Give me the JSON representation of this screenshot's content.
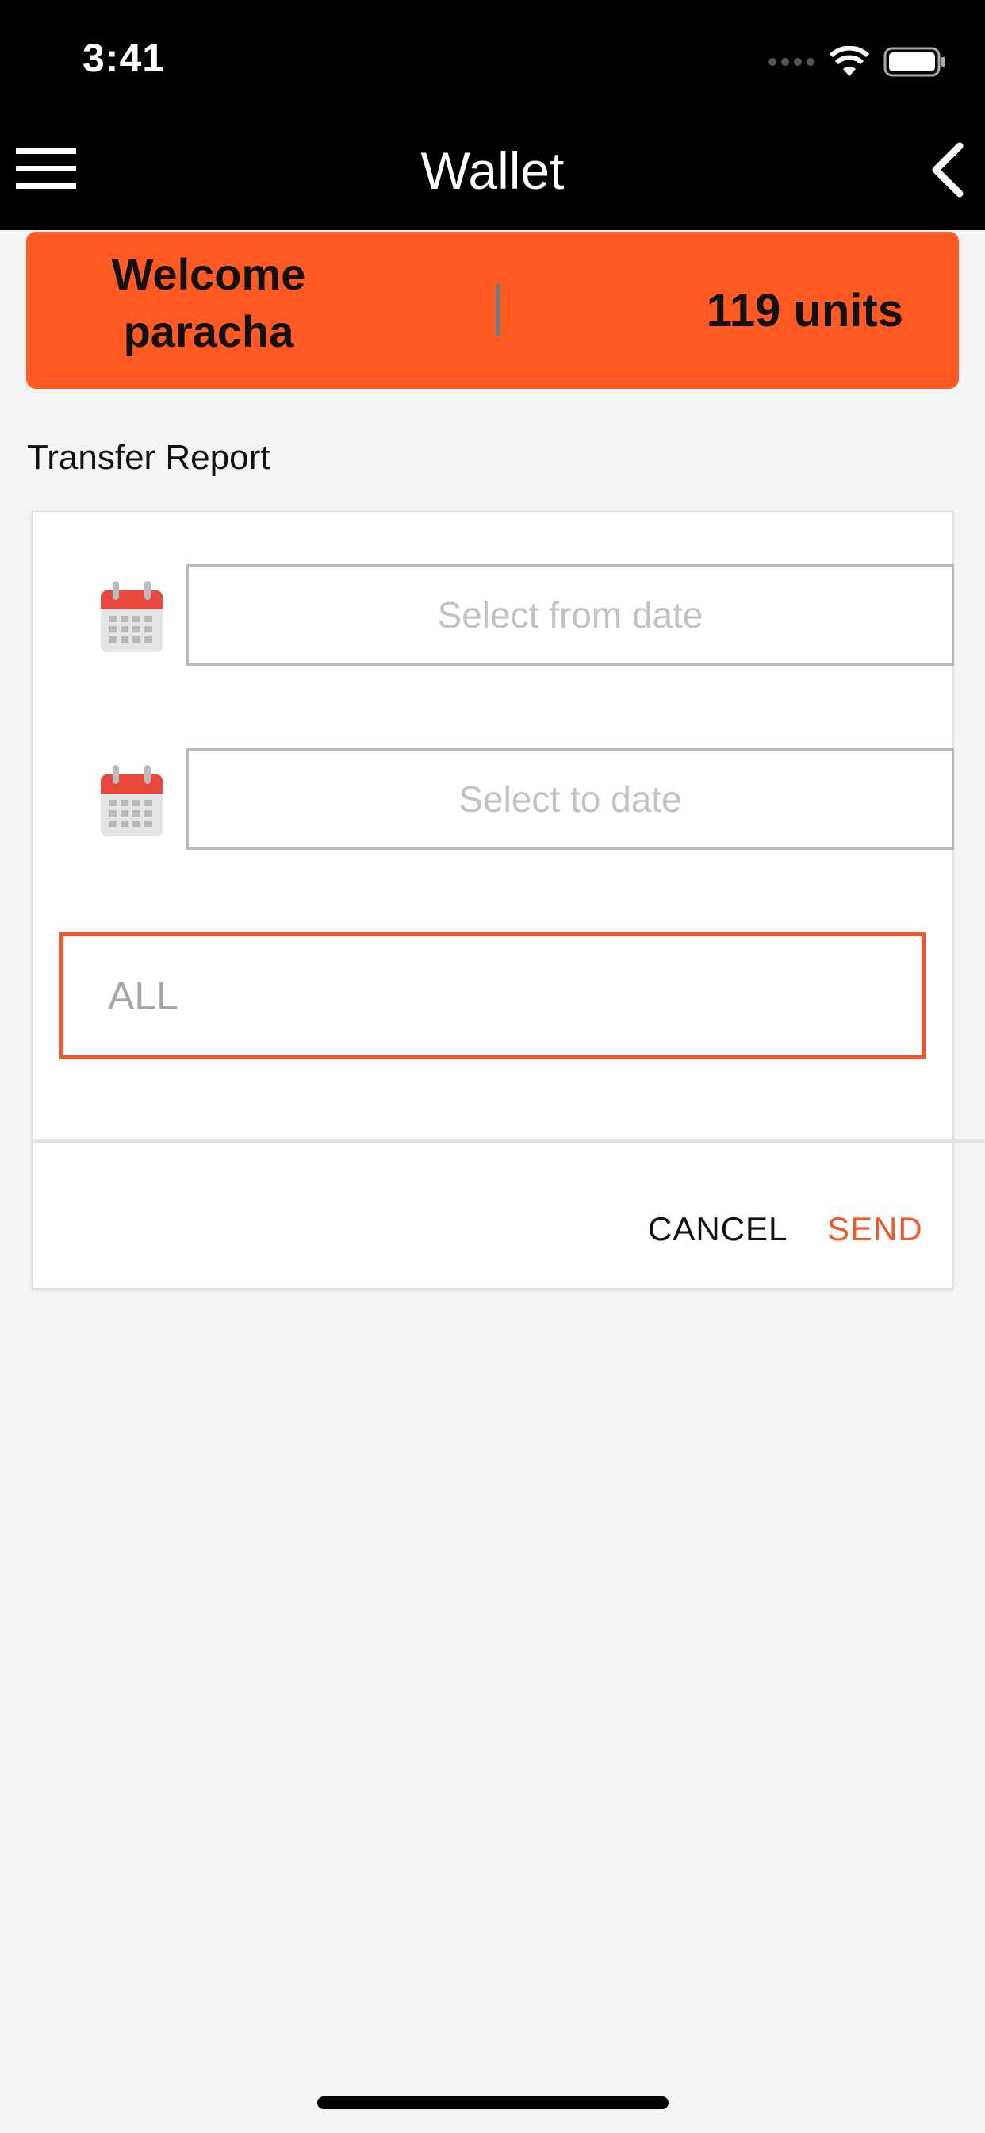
{
  "status_bar": {
    "time": "3:41",
    "icons": [
      "signal-dots-icon",
      "wifi-icon",
      "battery-icon"
    ]
  },
  "nav": {
    "title": "Wallet",
    "menu_icon": "hamburger-menu-icon",
    "back_icon": "chevron-left-icon"
  },
  "banner": {
    "welcome": "Welcome paracha",
    "balance": "119 units",
    "background": "#ff5a23"
  },
  "report": {
    "title": "Transfer Report",
    "from_placeholder": "Select from date",
    "to_placeholder": "Select to date",
    "type_value": "ALL",
    "cancel_label": "CANCEL",
    "send_label": "SEND"
  },
  "colors": {
    "accent": "#f0572a",
    "nav_bg": "#000000",
    "page_bg": "#f4f4f4"
  }
}
